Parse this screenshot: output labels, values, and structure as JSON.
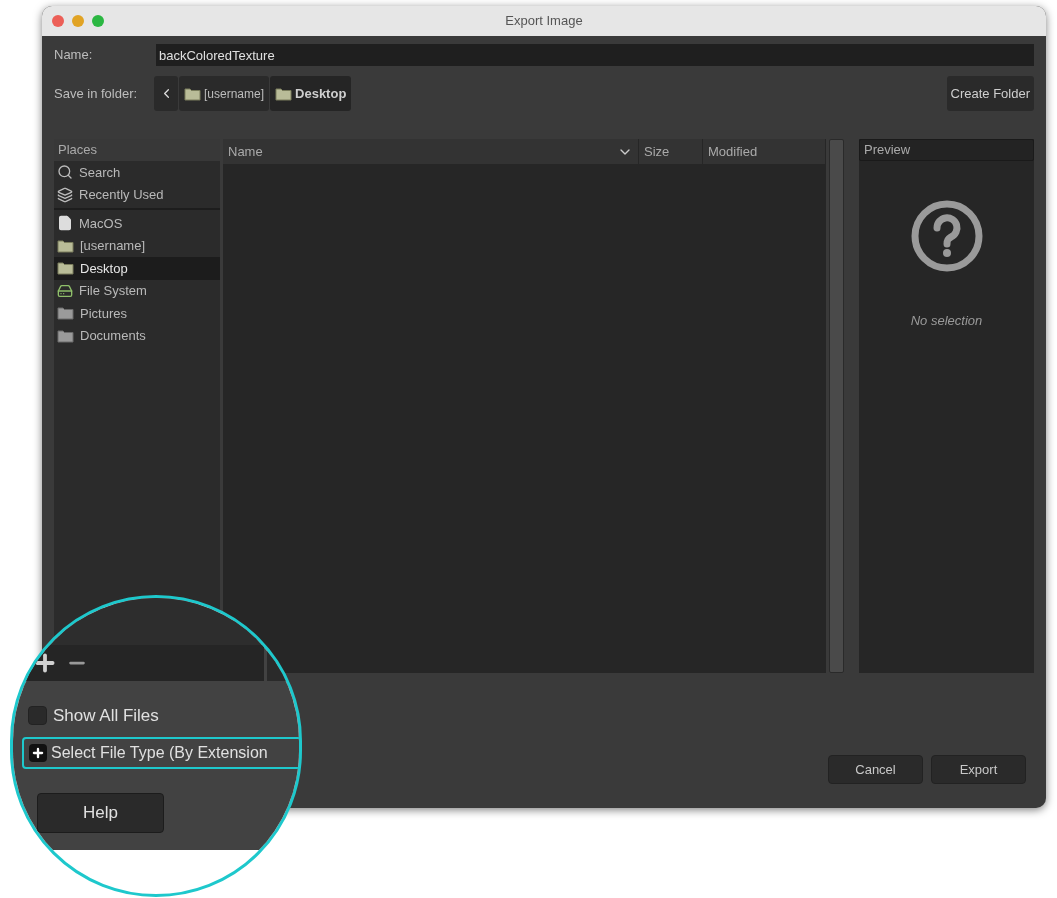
{
  "window": {
    "title": "Export Image"
  },
  "name_field": {
    "label": "Name:",
    "value": "backColoredTexture"
  },
  "save_in_folder": {
    "label": "Save in folder:",
    "path": [
      {
        "label": "[username]",
        "selected": false
      },
      {
        "label": "Desktop",
        "selected": true
      }
    ]
  },
  "create_folder_button": "Create Folder",
  "places": {
    "header": "Places",
    "sections": [
      {
        "items": [
          {
            "label": "Search",
            "kind": "search",
            "selected": false
          },
          {
            "label": "Recently Used",
            "kind": "recent",
            "selected": false
          }
        ]
      },
      {
        "items": [
          {
            "label": "MacOS",
            "kind": "file",
            "selected": false
          },
          {
            "label": "[username]",
            "kind": "folder",
            "selected": false
          },
          {
            "label": "Desktop",
            "kind": "folder",
            "selected": true
          },
          {
            "label": "File System",
            "kind": "drive",
            "selected": false
          },
          {
            "label": "Pictures",
            "kind": "gray-folder",
            "selected": false
          },
          {
            "label": "Documents",
            "kind": "gray-folder",
            "selected": false
          }
        ]
      }
    ]
  },
  "file_list": {
    "columns": [
      "Name",
      "Size",
      "Modified"
    ]
  },
  "preview": {
    "header": "Preview",
    "message": "No selection"
  },
  "magnifier": {
    "show_all_files": {
      "label": "Show All Files",
      "checked": false
    },
    "select_file_type": {
      "label": "Select File Type (By Extension",
      "expanded": false
    },
    "help_button": "Help"
  },
  "buttons": [
    "Cancel",
    "Export"
  ]
}
